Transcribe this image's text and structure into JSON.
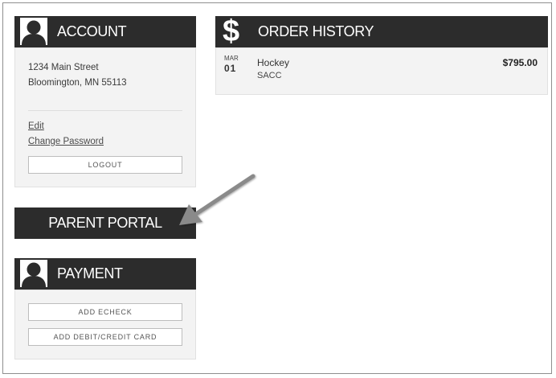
{
  "account": {
    "title": "ACCOUNT",
    "address_line1": "1234 Main Street",
    "address_line2": "Bloomington, MN 55113",
    "edit_label": "Edit",
    "change_password_label": "Change Password",
    "logout_label": "LOGOUT"
  },
  "parent_portal": {
    "label": "PARENT PORTAL"
  },
  "payment": {
    "title": "PAYMENT",
    "add_echeck_label": "ADD ECHECK",
    "add_card_label": "ADD DEBIT/CREDIT CARD"
  },
  "order_history": {
    "title": "ORDER HISTORY",
    "icon_glyph": "$",
    "orders": [
      {
        "month": "MAR",
        "day": "01",
        "title": "Hockey",
        "subtitle": "SACC",
        "amount": "$795.00"
      }
    ]
  },
  "icons": {
    "account": "user-icon",
    "payment": "user-icon",
    "order_history": "dollar-icon",
    "annotation": "arrow-icon"
  },
  "colors": {
    "header_bg": "#2c2c2c",
    "panel_bg": "#f3f3f3",
    "arrow": "#8a8a8a"
  }
}
